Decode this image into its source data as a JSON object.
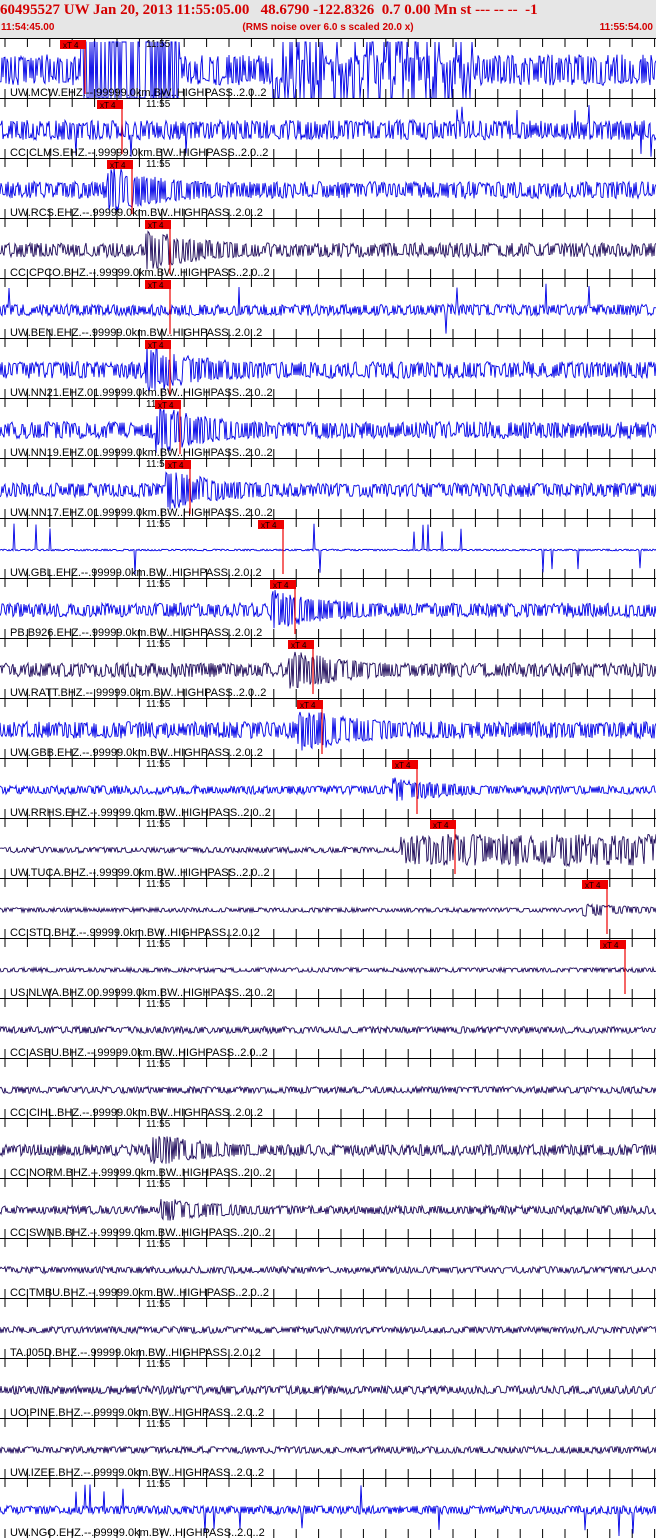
{
  "header": {
    "title": "60495527 UW Jan 20, 2013 11:55:05.00   48.6790 -122.8326  0.7 0.00 Mn st --- -- --  -1",
    "start_time": "11:54:45.00",
    "noise_note": "(RMS noise over 6.0 s scaled 20.0 x)",
    "end_time": "11:55:54.00"
  },
  "time_mark": "11:55",
  "pick_label": "xT 4",
  "colors": {
    "header_bg": "#e6e6e6",
    "header_text": "#d40000",
    "pick": "#ee0000",
    "trace_blue": "#0000e6",
    "trace_navy": "#1e0a5a"
  },
  "traces": [
    {
      "label": "UW.MCW.EHZ.--.99999.0km.BW..HIGHPASS..2.0..2",
      "color": "blue",
      "pick": true,
      "amp": 0.55,
      "activity": "saturated"
    },
    {
      "label": "CC.CLMS.EHZ.--.99999.0km.BW..HIGHPASS..2.0..2",
      "color": "blue",
      "pick": true,
      "amp": 0.35,
      "activity": "spikes"
    },
    {
      "label": "UW.RCS.EHZ.--.99999.0km.BW..HIGHPASS..2.0..2",
      "color": "blue",
      "pick": true,
      "amp": 0.3,
      "activity": "burst"
    },
    {
      "label": "CC.CPCO.BHZ.--.99999.0km.BW..HIGHPASS..2.0..2",
      "color": "navy",
      "pick": true,
      "amp": 0.25,
      "activity": "burst"
    },
    {
      "label": "UW.BEN.EHZ.--.99999.0km.BW..HIGHPASS..2.0..2",
      "color": "blue",
      "pick": true,
      "amp": 0.2,
      "activity": "spikes"
    },
    {
      "label": "UW.NN21.EHZ.01.99999.0km.BW..HIGHPASS..2.0..2",
      "color": "blue",
      "pick": true,
      "amp": 0.3,
      "activity": "burst"
    },
    {
      "label": "UW.NN19.EHZ.01.99999.0km.BW..HIGHPASS..2.0..2",
      "color": "blue",
      "pick": true,
      "amp": 0.3,
      "activity": "burst"
    },
    {
      "label": "UW.NN17.EHZ.01.99999.0km.BW..HIGHPASS..2.0..2",
      "color": "blue",
      "pick": true,
      "amp": 0.25,
      "activity": "burst"
    },
    {
      "label": "UW.GBL.EHZ.--.99999.0km.BW..HIGHPASS..2.0..2",
      "color": "blue",
      "pick": true,
      "amp": 0.03,
      "activity": "spikes"
    },
    {
      "label": "PB.B926.EHZ.--.99999.0km.BW..HIGHPASS..2.0..2",
      "color": "blue",
      "pick": true,
      "amp": 0.25,
      "activity": "burst"
    },
    {
      "label": "UW.RATT.BHZ.--.99999.0km.BW..HIGHPASS..2.0..2",
      "color": "navy",
      "pick": true,
      "amp": 0.25,
      "activity": "burst"
    },
    {
      "label": "UW.GBB.EHZ.--.99999.0km.BW..HIGHPASS..2.0..2",
      "color": "blue",
      "pick": true,
      "amp": 0.3,
      "activity": "burst"
    },
    {
      "label": "UW.RRHS.EHZ.--.99999.0km.BW..HIGHPASS..2.0..2",
      "color": "blue",
      "pick": true,
      "amp": 0.15,
      "activity": "burst"
    },
    {
      "label": "UW.TUCA.BHZ.--.99999.0km.BW..HIGHPASS..2.0..2",
      "color": "navy",
      "pick": true,
      "amp": 0.1,
      "activity": "storm"
    },
    {
      "label": "CC.STD.BHZ.--.99999.0km.BW..HIGHPASS..2.0..2",
      "color": "navy",
      "pick": true,
      "amp": 0.08,
      "activity": "burst"
    },
    {
      "label": "US.NLWA.BHZ.00.99999.0km.BW..HIGHPASS..2.0..2",
      "color": "navy",
      "pick": true,
      "amp": 0.08,
      "activity": "quiet"
    },
    {
      "label": "CC.ASBU.BHZ.--.99999.0km.BW..HIGHPASS..2.0..2",
      "color": "navy",
      "pick": false,
      "amp": 0.12,
      "activity": "quiet"
    },
    {
      "label": "CC.CIHL.BHZ.--.99999.0km.BW..HIGHPASS..2.0..2",
      "color": "navy",
      "pick": false,
      "amp": 0.12,
      "activity": "quiet"
    },
    {
      "label": "CC.NORM.BHZ.--.99999.0km.BW..HIGHPASS..2.0..2",
      "color": "navy",
      "pick": false,
      "amp": 0.2,
      "activity": "burst"
    },
    {
      "label": "CC.SWNB.BHZ.--.99999.0km.BW..HIGHPASS..2.0..2",
      "color": "navy",
      "pick": false,
      "amp": 0.15,
      "activity": "burst"
    },
    {
      "label": "CC.TMBU.BHZ.--.99999.0km.BW..HIGHPASS..2.0..2",
      "color": "navy",
      "pick": false,
      "amp": 0.12,
      "activity": "quiet"
    },
    {
      "label": "TA.J05D.BHZ.--.99999.0km.BW..HIGHPASS..2.0..2",
      "color": "navy",
      "pick": false,
      "amp": 0.12,
      "activity": "quiet"
    },
    {
      "label": "UO.PINE.BHZ.--.99999.0km.BW..HIGHPASS..2.0..2",
      "color": "navy",
      "pick": false,
      "amp": 0.15,
      "activity": "quiet"
    },
    {
      "label": "UW.IZEE.BHZ.--.99999.0km.BW..HIGHPASS..2.0..2",
      "color": "navy",
      "pick": false,
      "amp": 0.12,
      "activity": "quiet"
    },
    {
      "label": "UW.NGO.EHZ.--.99999.0km.BW..HIGHPASS..2.0..2",
      "color": "blue",
      "pick": false,
      "amp": 0.15,
      "activity": "spikes"
    }
  ]
}
